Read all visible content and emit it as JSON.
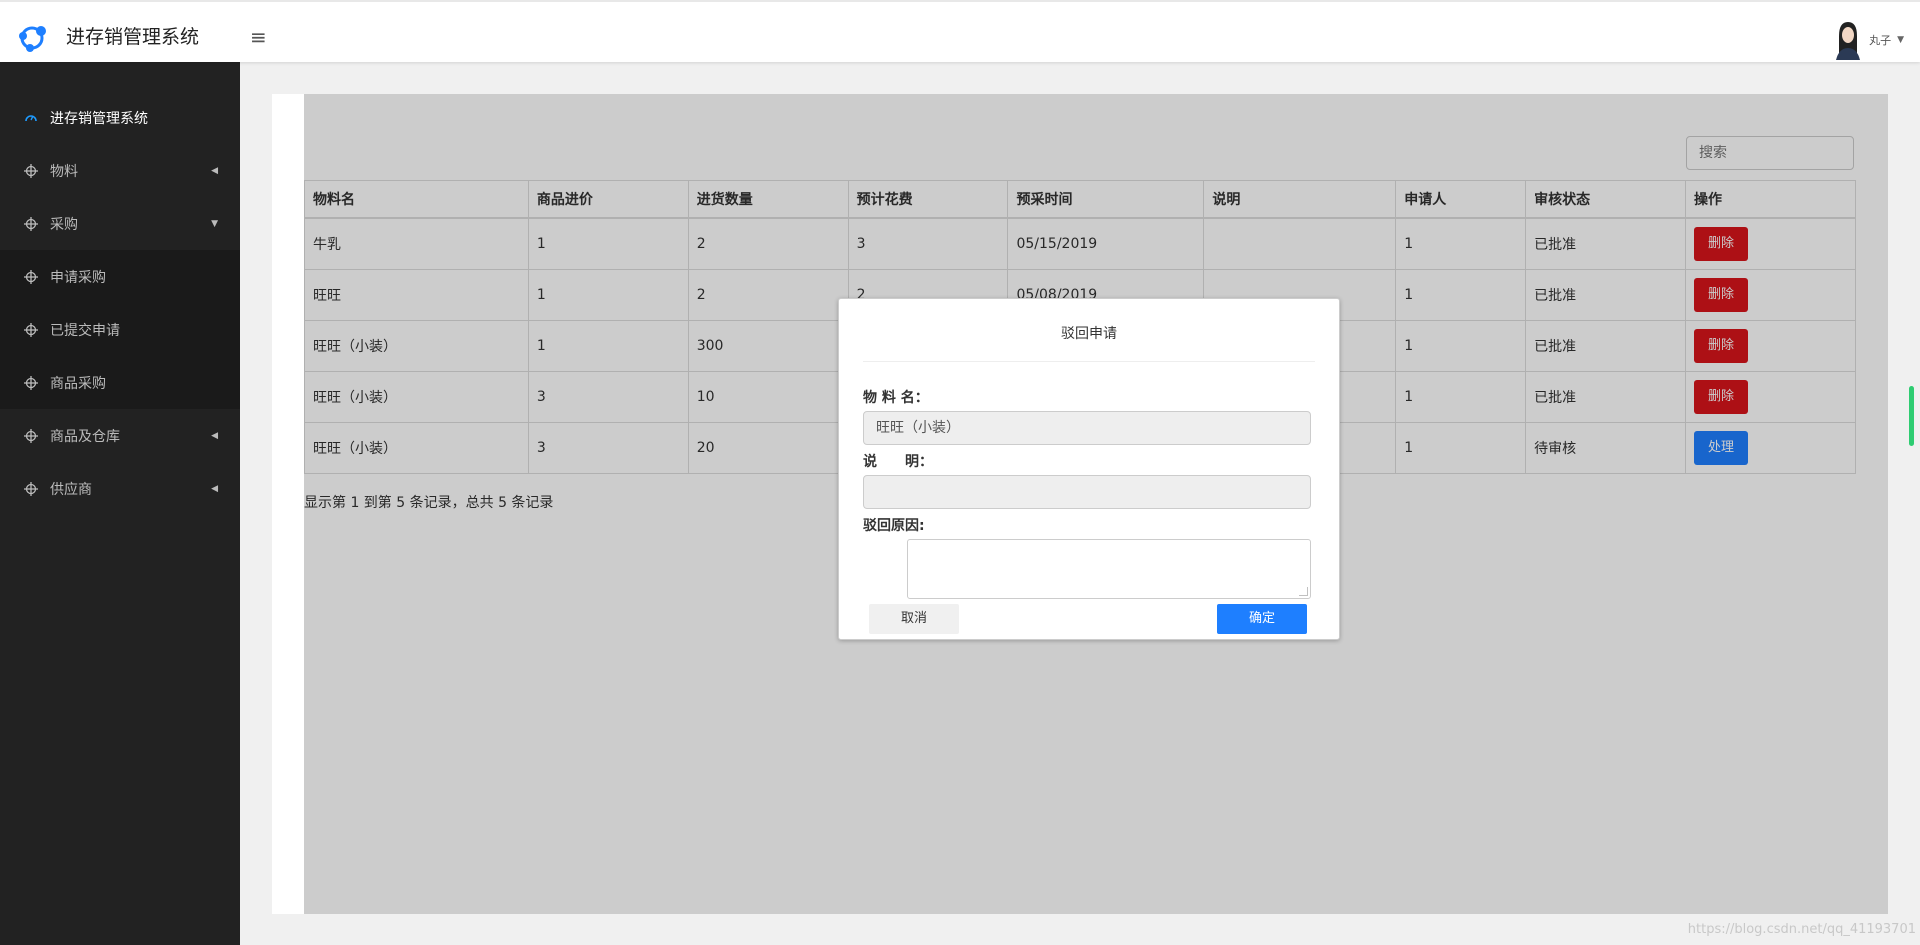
{
  "app": {
    "title": "进存销管理系统"
  },
  "header": {
    "user_name": "丸子"
  },
  "sidebar": {
    "items": [
      {
        "label": "进存销管理系统",
        "icon": "dashboard-icon"
      },
      {
        "label": "物料",
        "icon": "crosshair-icon"
      },
      {
        "label": "采购",
        "icon": "crosshair-icon"
      },
      {
        "label": "申请采购",
        "icon": "crosshair-icon"
      },
      {
        "label": "已提交申请",
        "icon": "crosshair-icon"
      },
      {
        "label": "商品采购",
        "icon": "crosshair-icon"
      },
      {
        "label": "商品及仓库",
        "icon": "crosshair-icon"
      },
      {
        "label": "供应商",
        "icon": "crosshair-icon"
      }
    ]
  },
  "search": {
    "placeholder": "搜索"
  },
  "table": {
    "headers": [
      "物料名",
      "商品进价",
      "进货数量",
      "预计花费",
      "预采时间",
      "说明",
      "申请人",
      "审核状态",
      "操作"
    ],
    "rows": [
      {
        "name": "牛乳",
        "price": "1",
        "qty": "2",
        "cost": "3",
        "date": "05/15/2019",
        "note": "",
        "applicant": "1",
        "status": "已批准",
        "action": "删除"
      },
      {
        "name": "旺旺",
        "price": "1",
        "qty": "2",
        "cost": "2",
        "date": "05/08/2019",
        "note": "",
        "applicant": "1",
        "status": "已批准",
        "action": "删除"
      },
      {
        "name": "旺旺（小装）",
        "price": "1",
        "qty": "300",
        "cost": "",
        "date": "",
        "note": "",
        "applicant": "1",
        "status": "已批准",
        "action": "删除"
      },
      {
        "name": "旺旺（小装）",
        "price": "3",
        "qty": "10",
        "cost": "",
        "date": "",
        "note": "",
        "applicant": "1",
        "status": "已批准",
        "action": "删除"
      },
      {
        "name": "旺旺（小装）",
        "price": "3",
        "qty": "20",
        "cost": "",
        "date": "",
        "note": "",
        "applicant": "1",
        "status": "待审核",
        "action": "处理"
      }
    ]
  },
  "footer": {
    "info": "显示第 1 到第 5 条记录，总共 5 条记录"
  },
  "modal": {
    "title": "驳回申请",
    "material_label": "物 料 名：",
    "material_value": "旺旺（小装）",
    "note_label": "说　　明：",
    "note_value": "",
    "reason_label": "驳回原因:",
    "cancel_label": "取消",
    "ok_label": "确定"
  },
  "watermark": "https://blog.csdn.net/qq_41193701",
  "colors": {
    "danger": "#d9141b",
    "primary": "#1e7fff",
    "sidebar": "#222222"
  }
}
